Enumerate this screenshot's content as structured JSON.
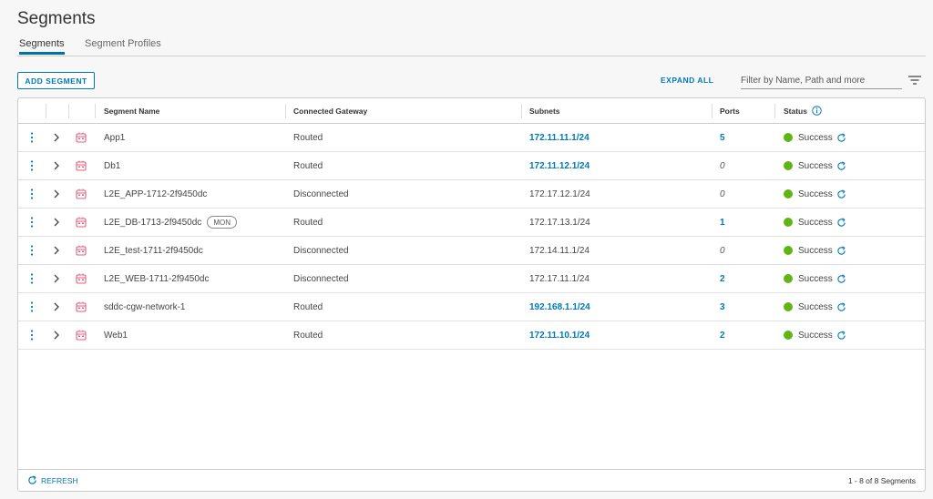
{
  "page": {
    "title": "Segments",
    "tabs": [
      {
        "label": "Segments",
        "active": true
      },
      {
        "label": "Segment Profiles",
        "active": false
      }
    ]
  },
  "toolbar": {
    "add_label": "ADD SEGMENT",
    "expand_all_label": "EXPAND ALL",
    "filter_placeholder": "Filter by Name, Path and more"
  },
  "table": {
    "columns": [
      "Segment Name",
      "Connected Gateway",
      "Subnets",
      "Ports",
      "Status"
    ],
    "rows": [
      {
        "name": "App1",
        "gateway": "Routed",
        "subnet": "172.11.11.1/24",
        "subnet_link": true,
        "ports": "5",
        "ports_link": true,
        "status": "Success"
      },
      {
        "name": "Db1",
        "gateway": "Routed",
        "subnet": "172.11.12.1/24",
        "subnet_link": true,
        "ports": "0",
        "ports_link": false,
        "status": "Success"
      },
      {
        "name": "L2E_APP-1712-2f9450dc",
        "gateway": "Disconnected",
        "subnet": "172.17.12.1/24",
        "subnet_link": false,
        "ports": "0",
        "ports_link": false,
        "status": "Success"
      },
      {
        "name": "L2E_DB-1713-2f9450dc",
        "badge": "MON",
        "gateway": "Routed",
        "subnet": "172.17.13.1/24",
        "subnet_link": false,
        "ports": "1",
        "ports_link": true,
        "status": "Success"
      },
      {
        "name": "L2E_test-1711-2f9450dc",
        "gateway": "Disconnected",
        "subnet": "172.14.11.1/24",
        "subnet_link": false,
        "ports": "0",
        "ports_link": false,
        "status": "Success"
      },
      {
        "name": "L2E_WEB-1711-2f9450dc",
        "gateway": "Disconnected",
        "subnet": "172.17.11.1/24",
        "subnet_link": false,
        "ports": "2",
        "ports_link": true,
        "status": "Success"
      },
      {
        "name": "sddc-cgw-network-1",
        "gateway": "Routed",
        "subnet": "192.168.1.1/24",
        "subnet_link": true,
        "ports": "3",
        "ports_link": true,
        "status": "Success"
      },
      {
        "name": "Web1",
        "gateway": "Routed",
        "subnet": "172.11.10.1/24",
        "subnet_link": true,
        "ports": "2",
        "ports_link": true,
        "status": "Success"
      }
    ]
  },
  "footer": {
    "refresh_label": "REFRESH",
    "count": "1 - 8 of 8 Segments"
  },
  "colors": {
    "accent": "#0079b8",
    "success": "#60b515",
    "segment_icon": "#e0607e"
  },
  "icons": [
    "vertical-dots-icon",
    "chevron-right-icon",
    "segment-icon",
    "info-icon",
    "refresh-icon",
    "filter-lines-icon"
  ]
}
